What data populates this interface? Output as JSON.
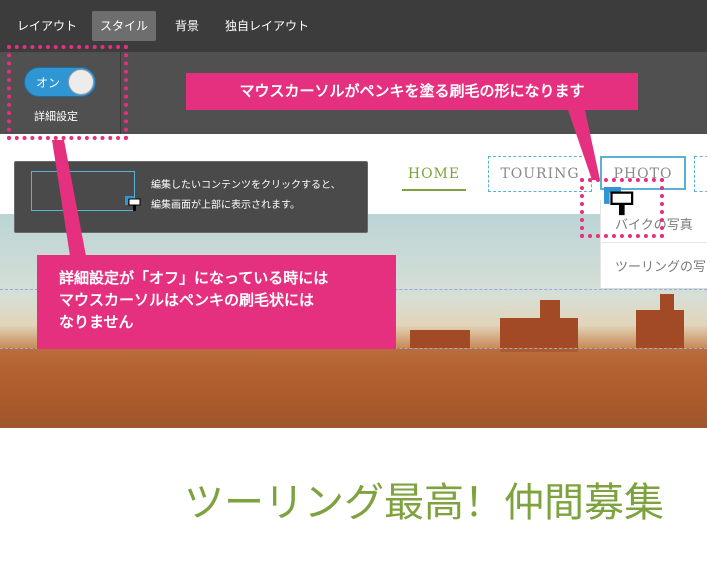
{
  "tabs": [
    {
      "label": "レイアウト",
      "active": false
    },
    {
      "label": "スタイル",
      "active": true
    },
    {
      "label": "背景",
      "active": false
    },
    {
      "label": "独自レイアウト",
      "active": false
    }
  ],
  "settings": {
    "toggle_label": "オン",
    "toggle_on": true,
    "advanced_label": "詳細設定"
  },
  "callout_top": "マウスカーソルがペンキを塗る刷毛の形になります",
  "callout_left": {
    "line1": "詳細設定が「オフ」になっている時には",
    "line2": "マウスカーソルはペンキの刷毛状には",
    "line3": "なりません"
  },
  "tooltip": {
    "line1": "編集したいコンテンツをクリックすると、",
    "line2": "編集画面が上部に表示されます。"
  },
  "nav": {
    "home": "HOME",
    "touring": "TOURING",
    "photo": "PHOTO"
  },
  "dropdown": [
    "バイクの写真",
    "ツーリングの写"
  ],
  "headline": "ツーリング最高！仲間募集",
  "colors": {
    "accent_pink": "#e5307f",
    "toggle_blue": "#2f95d3",
    "headline_green": "#7da23e",
    "topbar": "#3c3c3c"
  },
  "icons": [
    "paint-brush-cursor-icon"
  ]
}
